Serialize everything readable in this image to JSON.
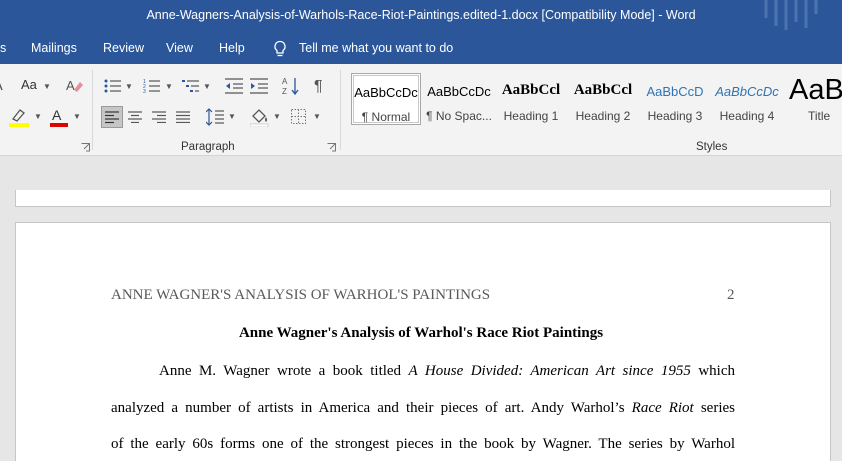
{
  "window": {
    "title": "Anne-Wagners-Analysis-of-Warhols-Race-Riot-Paintings.edited-1.docx [Compatibility Mode]  -  Word"
  },
  "tabs": {
    "partial": "s",
    "mailings": "Mailings",
    "review": "Review",
    "view": "View",
    "help": "Help",
    "tell_me": "Tell me what you want to do"
  },
  "ribbon": {
    "font_size_label": "Aa",
    "paragraph_label": "Paragraph",
    "styles_label": "Styles",
    "styles": [
      {
        "sample": "AaBbCcDc",
        "name": "¶ Normal"
      },
      {
        "sample": "AaBbCcDc",
        "name": "¶ No Spac..."
      },
      {
        "sample": "AaBbCcl",
        "name": "Heading 1"
      },
      {
        "sample": "AaBbCcl",
        "name": "Heading 2"
      },
      {
        "sample": "AaBbCcD",
        "name": "Heading 3"
      },
      {
        "sample": "AaBbCcDc",
        "name": "Heading 4"
      },
      {
        "sample": "AaB",
        "name": "Title"
      }
    ]
  },
  "document": {
    "header_left": "ANNE WAGNER'S ANALYSIS OF WARHOL'S PAINTINGS",
    "page_number": "2",
    "title": "Anne Wagner's Analysis of Warhol's Race Riot Paintings",
    "line1_a": "Anne M. Wagner wrote a book titled ",
    "line1_b": "A House Divided: American Art since 1955",
    "line1_c": " which",
    "line2_a": "analyzed a number of artists in America and their pieces of art. Andy Warhol’s ",
    "line2_b": "Race Riot",
    "line2_c": " series",
    "line3": "of the early 60s forms one of the strongest pieces in the book by Wagner. The series by Warhol"
  },
  "colors": {
    "titlebar": "#2b579a",
    "ribbon": "#f3f3f3",
    "heading_blue": "#2e74b5",
    "text_highlight": "#ffff00",
    "font_color_red": "#e00000"
  }
}
